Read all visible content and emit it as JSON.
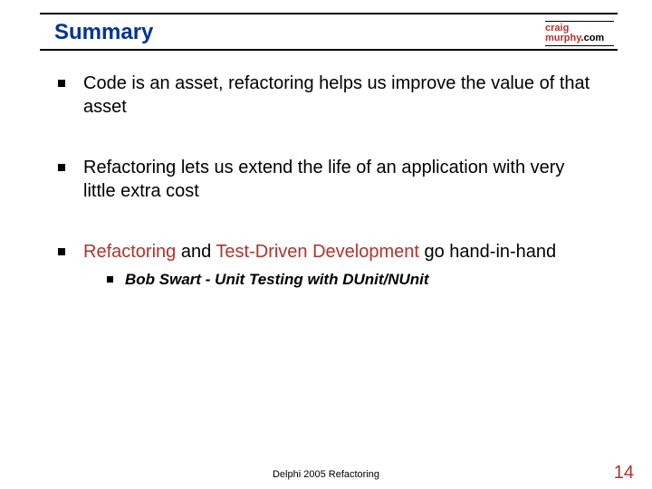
{
  "title": "Summary",
  "logo": {
    "line1": "craig",
    "line2a": "murphy",
    "line2b": ".com"
  },
  "bullets": [
    {
      "text": "Code is an asset, refactoring helps us improve the value of that asset"
    },
    {
      "text": "Refactoring lets us extend the life of an application with very little extra cost"
    },
    {
      "seg": [
        "Refactoring",
        " and ",
        "Test-Driven Development",
        " go hand-in-hand"
      ],
      "sub": [
        "Bob Swart - Unit Testing with DUnit/NUnit"
      ]
    }
  ],
  "footer": "Delphi 2005 Refactoring",
  "page": "14",
  "colors": {
    "accent": "#b2322d",
    "heading": "#003399"
  }
}
